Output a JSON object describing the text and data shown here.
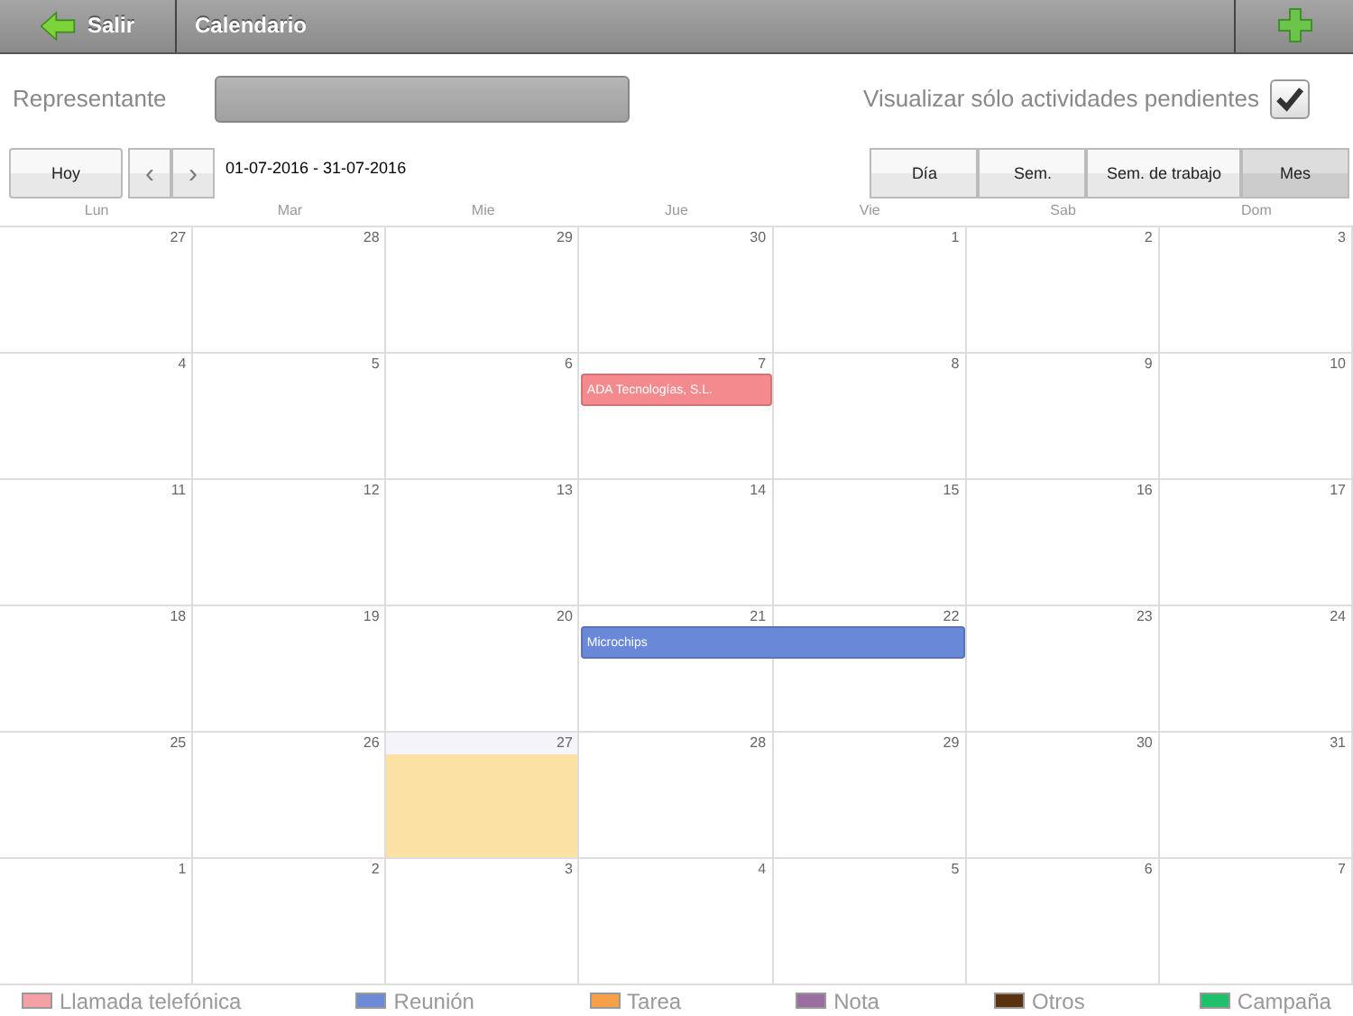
{
  "header": {
    "back_label": "Salir",
    "title": "Calendario"
  },
  "filter": {
    "label": "Representante",
    "pending_label": "Visualizar sólo actividades pendientes",
    "pending_checked": true
  },
  "toolbar": {
    "today_label": "Hoy",
    "prev": "‹",
    "next": "›",
    "range": "01-07-2016 - 31-07-2016",
    "views": [
      {
        "label": "Día",
        "selected": false
      },
      {
        "label": "Sem.",
        "selected": false
      },
      {
        "label": "Sem. de trabajo",
        "selected": false
      },
      {
        "label": "Mes",
        "selected": true
      }
    ]
  },
  "weekdays": [
    "Lun",
    "Mar",
    "Mie",
    "Jue",
    "Vie",
    "Sab",
    "Dom"
  ],
  "weeks": [
    {
      "days": [
        {
          "num": "27",
          "today": false
        },
        {
          "num": "28",
          "today": false
        },
        {
          "num": "29",
          "today": false
        },
        {
          "num": "30",
          "today": false
        },
        {
          "num": "1",
          "today": false
        },
        {
          "num": "2",
          "today": false
        },
        {
          "num": "3",
          "today": false
        }
      ]
    },
    {
      "days": [
        {
          "num": "4",
          "today": false
        },
        {
          "num": "5",
          "today": false
        },
        {
          "num": "6",
          "today": false
        },
        {
          "num": "7",
          "today": false,
          "event": {
            "title": "ADA Tecnologías, S.L.",
            "color": "#f48a8e",
            "continued": false
          }
        },
        {
          "num": "8",
          "today": false
        },
        {
          "num": "9",
          "today": false
        },
        {
          "num": "10",
          "today": false
        }
      ]
    },
    {
      "days": [
        {
          "num": "11",
          "today": false
        },
        {
          "num": "12",
          "today": false
        },
        {
          "num": "13",
          "today": false
        },
        {
          "num": "14",
          "today": false
        },
        {
          "num": "15",
          "today": false
        },
        {
          "num": "16",
          "today": false
        },
        {
          "num": "17",
          "today": false
        }
      ]
    },
    {
      "days": [
        {
          "num": "18",
          "today": false
        },
        {
          "num": "19",
          "today": false
        },
        {
          "num": "20",
          "today": false
        },
        {
          "num": "21",
          "today": false,
          "event": {
            "title": "Microchips",
            "color": "#6a88d8",
            "continued": false
          }
        },
        {
          "num": "22",
          "today": false,
          "event": {
            "color": "#6a88d8",
            "continued": true
          }
        },
        {
          "num": "23",
          "today": false
        },
        {
          "num": "24",
          "today": false
        }
      ]
    },
    {
      "days": [
        {
          "num": "25",
          "today": false
        },
        {
          "num": "26",
          "today": false
        },
        {
          "num": "27",
          "today": true
        },
        {
          "num": "28",
          "today": false
        },
        {
          "num": "29",
          "today": false
        },
        {
          "num": "30",
          "today": false
        },
        {
          "num": "31",
          "today": false
        }
      ]
    },
    {
      "days": [
        {
          "num": "1",
          "today": false
        },
        {
          "num": "2",
          "today": false
        },
        {
          "num": "3",
          "today": false
        },
        {
          "num": "4",
          "today": false
        },
        {
          "num": "5",
          "today": false
        },
        {
          "num": "6",
          "today": false
        },
        {
          "num": "7",
          "today": false
        }
      ]
    }
  ],
  "legend": [
    {
      "label": "Llamada telefónica",
      "color": "#f4a0a4"
    },
    {
      "label": "Reunión",
      "color": "#6d8ad6"
    },
    {
      "label": "Tarea",
      "color": "#f6a04a"
    },
    {
      "label": "Nota",
      "color": "#9a6ea0"
    },
    {
      "label": "Otros",
      "color": "#5a3210"
    },
    {
      "label": "Campaña",
      "color": "#1ec06a"
    }
  ]
}
